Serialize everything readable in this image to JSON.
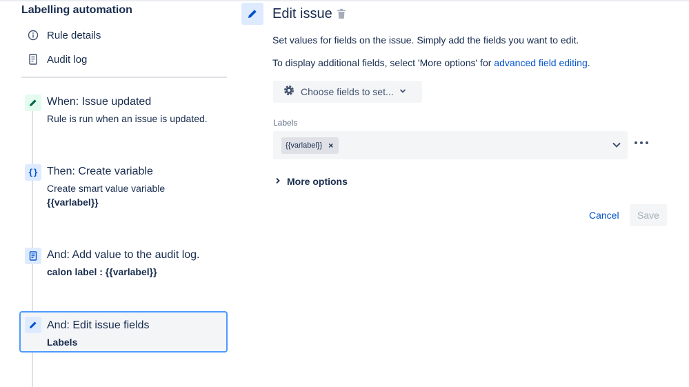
{
  "sidebar": {
    "title": "Labelling automation",
    "nav": [
      {
        "label": "Rule details",
        "icon": "info-icon"
      },
      {
        "label": "Audit log",
        "icon": "document-icon"
      }
    ],
    "steps": [
      {
        "title": "When: Issue updated",
        "sub": "Rule is run when an issue is updated.",
        "icon": "pencil-icon"
      },
      {
        "title": "Then: Create variable",
        "sub": "Create smart value variable",
        "sub2": "{{varlabel}}",
        "icon": "braces-icon",
        "icon_text": "{}"
      },
      {
        "title": "And: Add value to the audit log.",
        "sub": "calon label : {{varlabel}}",
        "icon": "document-icon"
      },
      {
        "title": "And: Edit issue fields",
        "sub": "Labels",
        "icon": "pencil-icon",
        "selected": true
      }
    ]
  },
  "main": {
    "title": "Edit issue",
    "desc1": "Set values for fields on the issue. Simply add the fields you want to edit.",
    "desc2_prefix": "To display additional fields, select 'More options' for ",
    "desc2_link": "advanced field editing",
    "desc2_suffix": ".",
    "choose_fields": "Choose fields to set...",
    "labels_field": {
      "label": "Labels",
      "tag": "{{varlabel}}",
      "tag_remove": "×"
    },
    "more_options": "More options",
    "cancel": "Cancel",
    "save": "Save"
  },
  "colors": {
    "accent": "#0052cc",
    "selected_border": "#4c9aff",
    "trigger_icon_bg": "#e3fcef",
    "action_icon_bg": "#deebff"
  }
}
